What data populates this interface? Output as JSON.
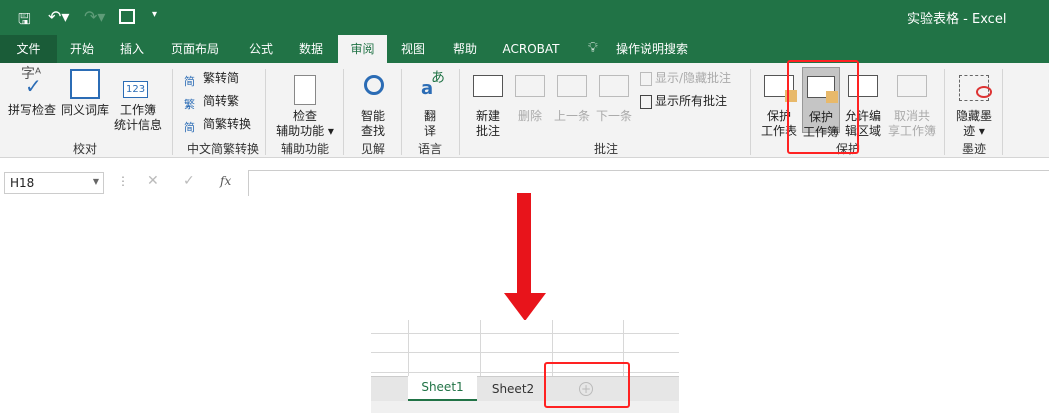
{
  "title": {
    "doc": "实验表格",
    "sep": "-",
    "app": "Excel"
  },
  "tabs": [
    "文件",
    "开始",
    "插入",
    "页面布局",
    "公式",
    "数据",
    "审阅",
    "视图",
    "帮助",
    "ACROBAT"
  ],
  "tell_me": "操作说明搜索",
  "ribbon": {
    "proofing": {
      "spell": "拼写检查",
      "thesaurus": "同义词库",
      "stats1": "工作簿",
      "stats2": "统计信息",
      "label": "校对"
    },
    "chinese": {
      "t2s": "繁转简",
      "s2t": "简转繁",
      "convert": "简繁转换",
      "label": "中文简繁转换",
      "i1": "简",
      "i2": "繁",
      "i3": "简"
    },
    "access": {
      "l1": "检查",
      "l2": "辅助功能",
      "label": "辅助功能"
    },
    "insights": {
      "l1": "智能",
      "l2": "查找",
      "label": "见解"
    },
    "language": {
      "l1": "翻",
      "l2": "译",
      "label": "语言"
    },
    "comments": {
      "new1": "新建",
      "new2": "批注",
      "delete": "删除",
      "prev": "上一条",
      "next": "下一条",
      "showhide": "显示/隐藏批注",
      "showall": "显示所有批注",
      "label": "批注"
    },
    "protect": {
      "sheet1": "保护",
      "sheet2": "工作表",
      "wb1": "保护",
      "wb2": "工作簿",
      "allow1": "允许编",
      "allow2": "辑区域",
      "unshare1": "取消共",
      "unshare2": "享工作簿",
      "label": "保护"
    },
    "ink": {
      "l1": "隐藏墨",
      "l2": "迹",
      "label": "墨迹"
    }
  },
  "formula": {
    "namebox": "H18",
    "fx": "fx"
  },
  "sheets": [
    "Sheet1",
    "Sheet2"
  ],
  "colors": {
    "accent": "#217346",
    "highlight": "#ff2222"
  }
}
